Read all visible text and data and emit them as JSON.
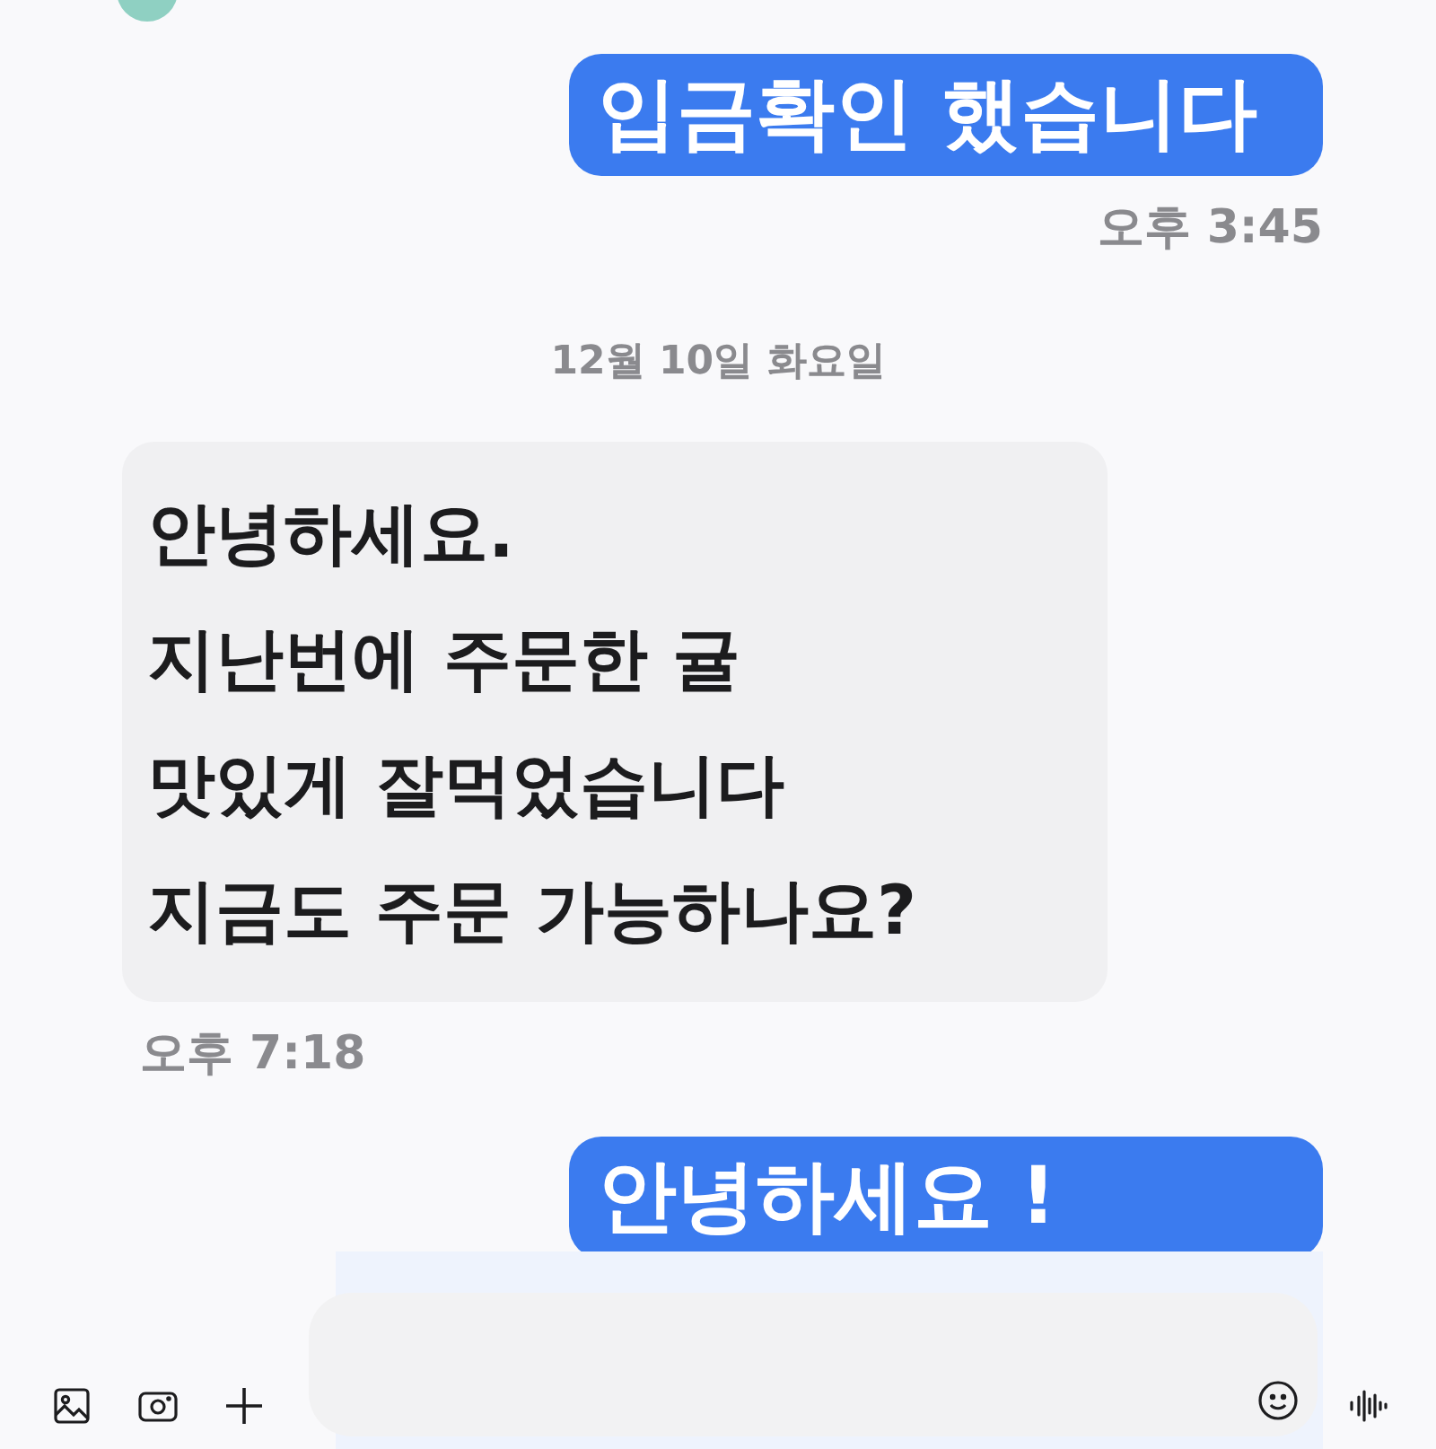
{
  "messages": [
    {
      "kind": "outgoing",
      "lines": [
        "입금확인 했습니다"
      ],
      "time": "오후 3:45"
    },
    {
      "kind": "date",
      "text": "12월 10일 화요일"
    },
    {
      "kind": "incoming",
      "lines": [
        "안녕하세요.",
        "지난번에 주문한 귤",
        "맛있게 잘먹었습니다",
        "지금도 주문 가능하나요?"
      ],
      "time": "오후 7:18"
    },
    {
      "kind": "outgoing",
      "lines": [
        "안녕하세요 !"
      ]
    }
  ]
}
